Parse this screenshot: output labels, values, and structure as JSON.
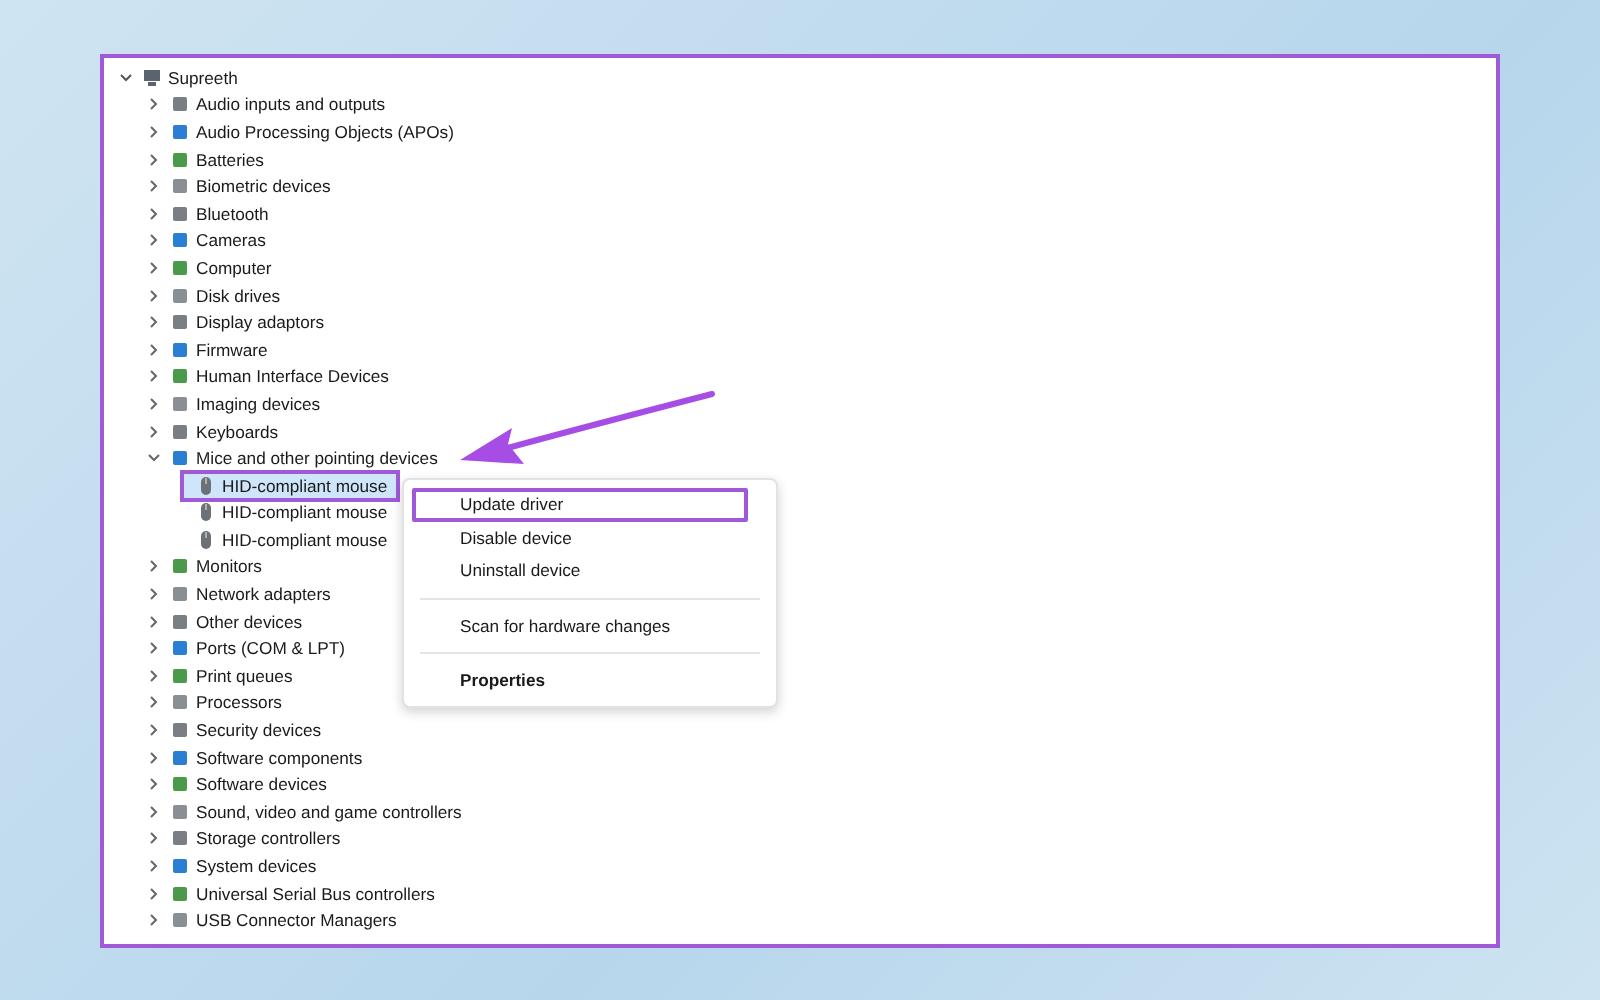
{
  "tree": {
    "label": "Supreeth",
    "expanded": true,
    "children": [
      {
        "label": "Audio inputs and outputs",
        "expanded": false
      },
      {
        "label": "Audio Processing Objects (APOs)",
        "expanded": false
      },
      {
        "label": "Batteries",
        "expanded": false
      },
      {
        "label": "Biometric devices",
        "expanded": false
      },
      {
        "label": "Bluetooth",
        "expanded": false
      },
      {
        "label": "Cameras",
        "expanded": false
      },
      {
        "label": "Computer",
        "expanded": false
      },
      {
        "label": "Disk drives",
        "expanded": false
      },
      {
        "label": "Display adaptors",
        "expanded": false
      },
      {
        "label": "Firmware",
        "expanded": false
      },
      {
        "label": "Human Interface Devices",
        "expanded": false
      },
      {
        "label": "Imaging devices",
        "expanded": false
      },
      {
        "label": "Keyboards",
        "expanded": false
      },
      {
        "label": "Mice and other pointing devices",
        "expanded": true,
        "children": [
          {
            "label": "HID-compliant mouse",
            "selected": true
          },
          {
            "label": "HID-compliant mouse",
            "selected": false
          },
          {
            "label": "HID-compliant mouse",
            "selected": false
          }
        ]
      },
      {
        "label": "Monitors",
        "expanded": false
      },
      {
        "label": "Network adapters",
        "expanded": false
      },
      {
        "label": "Other devices",
        "expanded": false
      },
      {
        "label": "Ports (COM & LPT)",
        "expanded": false
      },
      {
        "label": "Print queues",
        "expanded": false
      },
      {
        "label": "Processors",
        "expanded": false
      },
      {
        "label": "Security devices",
        "expanded": false
      },
      {
        "label": "Software components",
        "expanded": false
      },
      {
        "label": "Software devices",
        "expanded": false
      },
      {
        "label": "Sound, video and game controllers",
        "expanded": false
      },
      {
        "label": "Storage controllers",
        "expanded": false
      },
      {
        "label": "System devices",
        "expanded": false
      },
      {
        "label": "Universal Serial Bus controllers",
        "expanded": false
      },
      {
        "label": "USB Connector Managers",
        "expanded": false
      }
    ]
  },
  "context_menu": {
    "items": [
      {
        "kind": "item",
        "label": "Update driver",
        "highlighted": true
      },
      {
        "kind": "item",
        "label": "Disable device",
        "highlighted": false
      },
      {
        "kind": "item",
        "label": "Uninstall device",
        "highlighted": false
      },
      {
        "kind": "separator"
      },
      {
        "kind": "item",
        "label": "Scan for hardware changes",
        "highlighted": false
      },
      {
        "kind": "separator"
      },
      {
        "kind": "default",
        "label": "Properties",
        "highlighted": false
      }
    ]
  }
}
